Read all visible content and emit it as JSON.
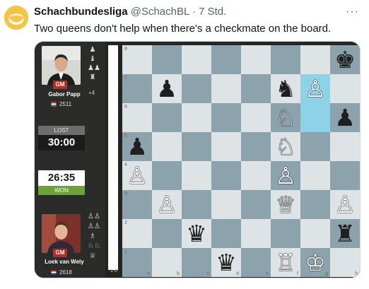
{
  "tweet": {
    "author_name": "Schachbundesliga",
    "handle": "@SchachBL",
    "separator": "·",
    "timestamp": "7 Std.",
    "more": "···",
    "text": "Two queens don't help when there's a checkmate on the board."
  },
  "players": {
    "top": {
      "name": "Gabor Papp",
      "title": "GM",
      "rating": "2511",
      "country": "Hungary",
      "material": "+4",
      "clock_label": "LOST",
      "clock": "30:00",
      "captured_icons": [
        "♟",
        "♝",
        "♟♟",
        "♜"
      ]
    },
    "bottom": {
      "name": "Loek van Wely",
      "title": "GM",
      "rating": "2618",
      "country": "Netherlands",
      "clock_label": "WON",
      "clock": "26:35",
      "captured_icons": [
        "♙♙",
        "♙♙",
        "♗",
        "♘♘",
        "♕"
      ]
    }
  },
  "result": "1-0",
  "board": {
    "ranks": [
      "8",
      "7",
      "6",
      "5",
      "4",
      "3",
      "2",
      "1"
    ],
    "files": [
      "a",
      "b",
      "c",
      "d",
      "e",
      "f",
      "g",
      "h"
    ],
    "highlight_squares": [
      "g7",
      "g6"
    ],
    "pieces": [
      {
        "sq": "h8",
        "color": "b",
        "glyph": "♚"
      },
      {
        "sq": "b7",
        "color": "b",
        "glyph": "♟"
      },
      {
        "sq": "f7",
        "color": "b",
        "glyph": "♞"
      },
      {
        "sq": "g7",
        "color": "w",
        "glyph": "♙"
      },
      {
        "sq": "f6",
        "color": "w",
        "glyph": "♘"
      },
      {
        "sq": "h6",
        "color": "b",
        "glyph": "♟"
      },
      {
        "sq": "a5",
        "color": "b",
        "glyph": "♟"
      },
      {
        "sq": "f5",
        "color": "w",
        "glyph": "♘"
      },
      {
        "sq": "a4",
        "color": "w",
        "glyph": "♙"
      },
      {
        "sq": "f4",
        "color": "w",
        "glyph": "♙"
      },
      {
        "sq": "b3",
        "color": "w",
        "glyph": "♙"
      },
      {
        "sq": "f3",
        "color": "w",
        "glyph": "♕"
      },
      {
        "sq": "h3",
        "color": "w",
        "glyph": "♙"
      },
      {
        "sq": "c2",
        "color": "b",
        "glyph": "♛"
      },
      {
        "sq": "h2",
        "color": "b",
        "glyph": "♜"
      },
      {
        "sq": "d1",
        "color": "b",
        "glyph": "♛"
      },
      {
        "sq": "f1",
        "color": "w",
        "glyph": "♖"
      },
      {
        "sq": "g1",
        "color": "w",
        "glyph": "♔"
      }
    ]
  }
}
